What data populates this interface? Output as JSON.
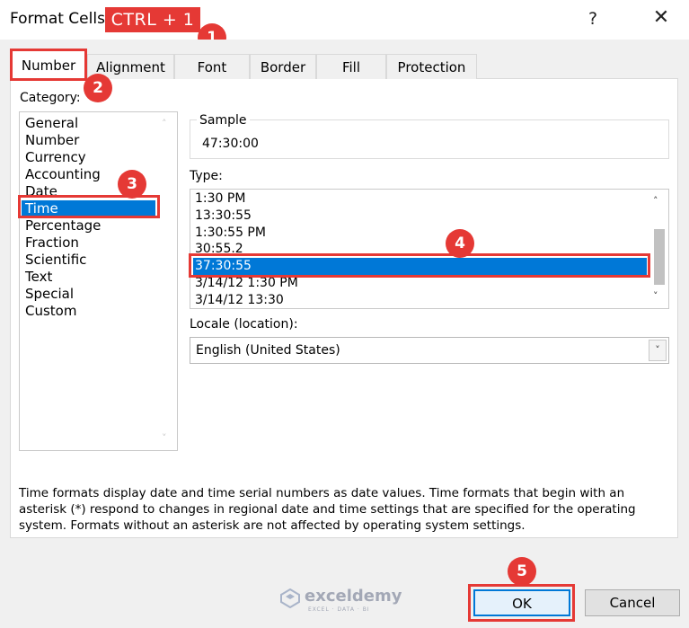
{
  "window": {
    "title": "Format Cells",
    "help_label": "?",
    "close_label": "✕"
  },
  "annotations": {
    "shortcut": "CTRL + 1",
    "steps": [
      "1",
      "2",
      "3",
      "4",
      "5"
    ]
  },
  "tabs": [
    "Number",
    "Alignment",
    "Font",
    "Border",
    "Fill",
    "Protection"
  ],
  "category": {
    "label": "Category:",
    "items": [
      "General",
      "Number",
      "Currency",
      "Accounting",
      "Date",
      "Time",
      "Percentage",
      "Fraction",
      "Scientific",
      "Text",
      "Special",
      "Custom"
    ],
    "selected": "Time"
  },
  "sample": {
    "label": "Sample",
    "value": "47:30:00"
  },
  "type": {
    "label": "Type:",
    "items": [
      "1:30 PM",
      "13:30:55",
      "1:30:55 PM",
      "30:55.2",
      "37:30:55",
      "3/14/12 1:30 PM",
      "3/14/12 13:30"
    ],
    "selected": "37:30:55"
  },
  "locale": {
    "label": "Locale (location):",
    "value": "English (United States)"
  },
  "description": "Time formats display date and time serial numbers as date values.  Time formats that begin with an asterisk (*) respond to changes in regional date and time settings that are specified for the operating system. Formats without an asterisk are not affected by operating system settings.",
  "buttons": {
    "ok": "OK",
    "cancel": "Cancel"
  },
  "watermark": {
    "name": "exceldemy",
    "tagline": "EXCEL · DATA · BI"
  },
  "colors": {
    "accent": "#0078d7",
    "callout": "#e53935"
  }
}
